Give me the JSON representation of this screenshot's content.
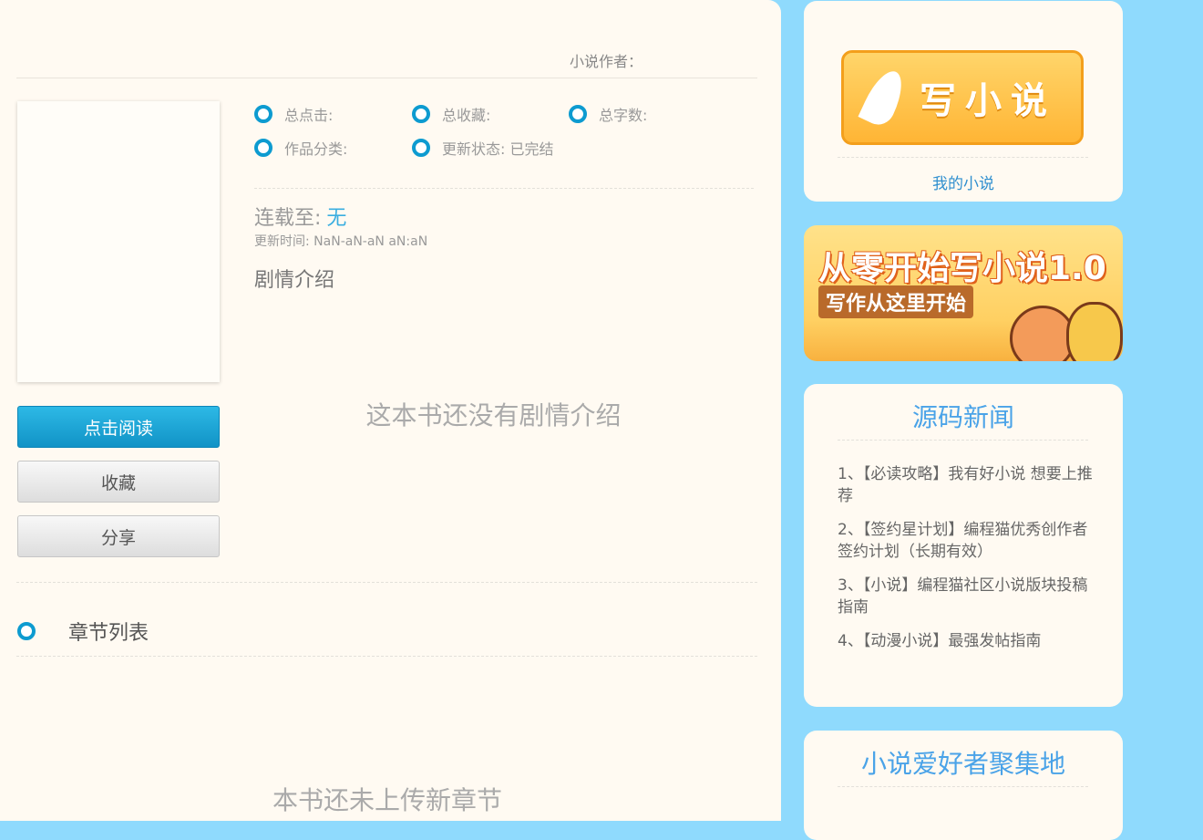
{
  "book": {
    "author_label": "小说作者：",
    "stats": [
      {
        "label": "总点击:"
      },
      {
        "label": "总收藏:"
      },
      {
        "label": "总字数:"
      },
      {
        "label": "作品分类:"
      },
      {
        "label": "更新状态: 已完结"
      }
    ],
    "serial_label": "连载至:",
    "serial_value": "无",
    "update_time": "更新时间: NaN-aN-aN aN:aN",
    "plot_title": "剧情介绍",
    "plot_empty": "这本书还没有剧情介绍",
    "chapters_title": "章节列表",
    "chapters_empty": "本书还未上传新章节"
  },
  "actions": {
    "read": "点击阅读",
    "favorite": "收藏",
    "share": "分享"
  },
  "sidebar": {
    "write_banner": "写小说",
    "my_novels": "我的小说",
    "promo_title": "从零开始写小说1.0",
    "promo_subtitle": "写作从这里开始",
    "news_title": "源码新闻",
    "news": [
      "1、【必读攻略】我有好小说 想要上推荐",
      "2、【签约星计划】编程猫优秀创作者签约计划（长期有效）",
      "3、【小说】编程猫社区小说版块投稿指南",
      "4、【动漫小说】最强发帖指南"
    ],
    "fans_title": "小说爱好者聚集地"
  },
  "colors": {
    "page_bg": "#8fdafd",
    "card_bg": "#fffaf2",
    "accent": "#0d9bd0",
    "link": "#2f8fcf",
    "title_blue": "#4aa3e8"
  }
}
